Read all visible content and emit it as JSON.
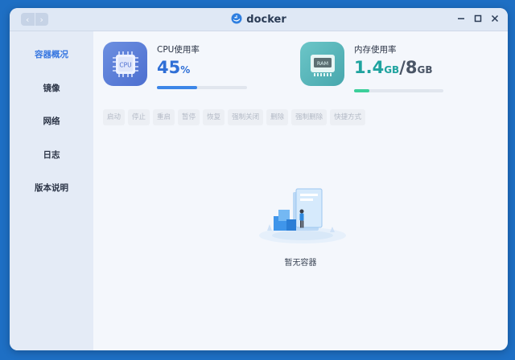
{
  "window": {
    "title": "docker"
  },
  "sidebar": {
    "items": [
      {
        "label": "容器概况",
        "active": true
      },
      {
        "label": "镜像",
        "active": false
      },
      {
        "label": "网络",
        "active": false
      },
      {
        "label": "日志",
        "active": false
      },
      {
        "label": "版本说明",
        "active": false
      }
    ]
  },
  "cpu": {
    "icon_text": "CPU",
    "label": "CPU使用率",
    "value": "45",
    "unit": "%",
    "progress_percent": 45
  },
  "memory": {
    "icon_text": "RAM",
    "label": "内存使用率",
    "used": "1.4",
    "used_unit": "GB",
    "separator": "/",
    "total": "8",
    "total_unit": "GB",
    "progress_fraction": 0.175
  },
  "toolbar": {
    "buttons": [
      "启动",
      "停止",
      "重启",
      "暂停",
      "恢复",
      "强制关闭",
      "删除",
      "强制删除",
      "快捷方式"
    ]
  },
  "empty_state": {
    "text": "暂无容器"
  },
  "colors": {
    "accent": "#3575e0",
    "cpu_value": "#2f6fd6",
    "mem_value": "#1fa39f",
    "cpu_bar": "#3c86e8",
    "mem_bar": "#3ccf9a",
    "desktop": "#1e6fc4"
  }
}
